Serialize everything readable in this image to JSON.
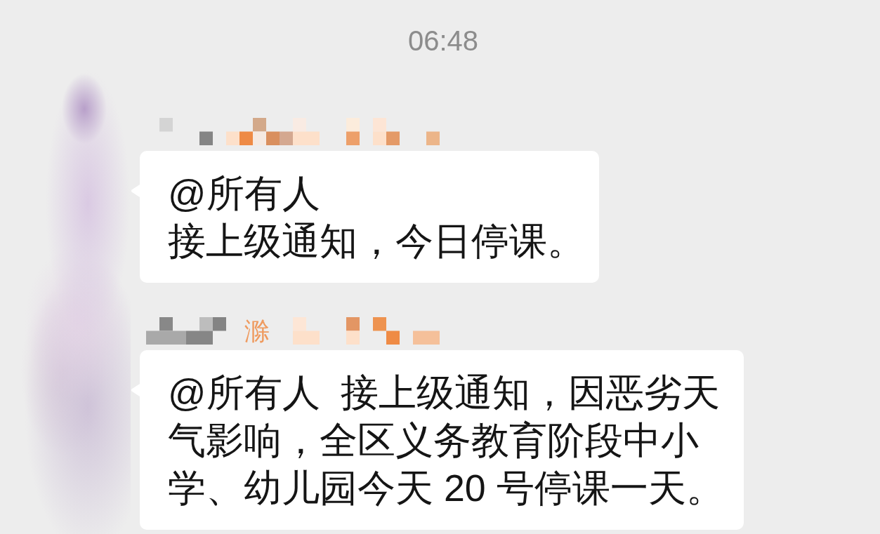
{
  "time_divider": {
    "text": "06:48"
  },
  "avatars_blurred": true,
  "messages": [
    {
      "sender": {
        "redacted": true
      },
      "paragraphs": [
        "@所有人",
        "接上级通知，今日停课。"
      ]
    },
    {
      "sender": {
        "redacted": true,
        "visible_text": "滁"
      },
      "paragraphs": [
        "@所有人  接上级通知，因恶劣天气影响，全区义务教育阶段中小学、幼儿园今天 20 号停课一天。"
      ]
    }
  ]
}
